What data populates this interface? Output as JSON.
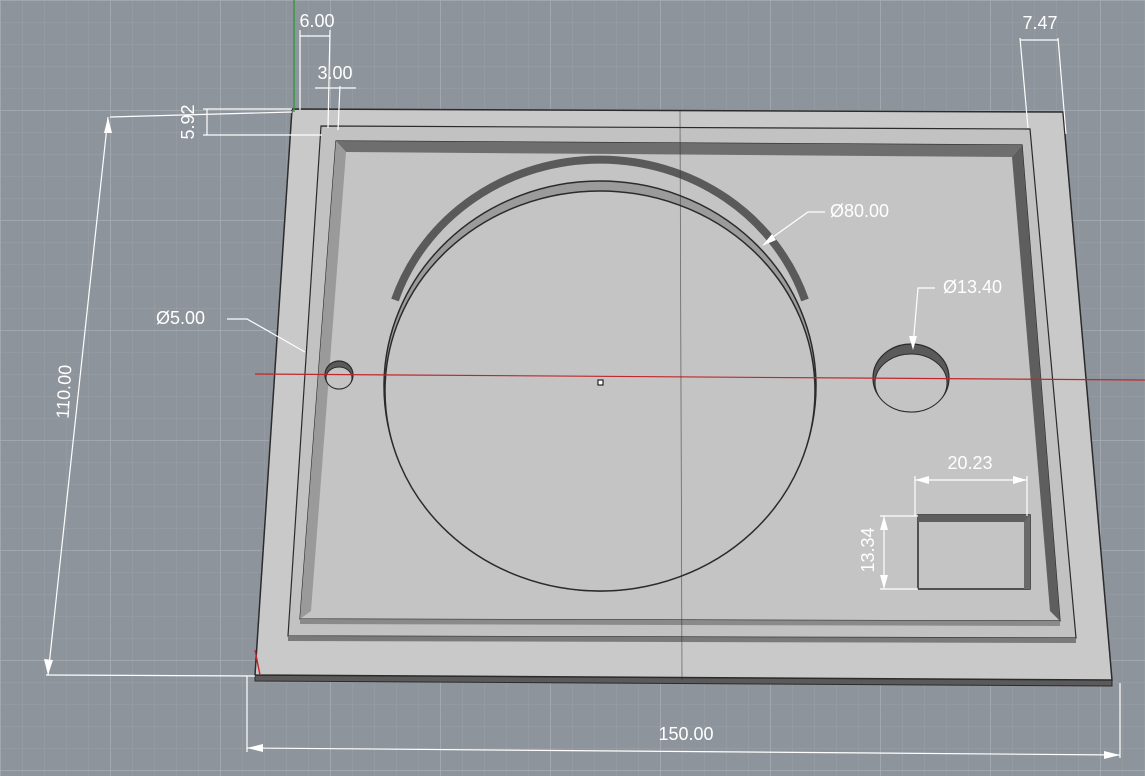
{
  "viewport": {
    "background": "#8e949b",
    "grid_minor_color": "#9aa0a6",
    "grid_major_color": "#a7adb3",
    "part_face_color": "#c7c7c7",
    "part_edge_color": "#2b2b2b",
    "x_axis_color": "#c0272d",
    "y_axis_color": "#2e9b3a"
  },
  "dimensions": {
    "width": "150.00",
    "height": "110.00",
    "border": "6.00",
    "inner_step": "3.00",
    "top_offset": "5.92",
    "right_offset": "7.47",
    "large_hole_dia": "Ø80.00",
    "small_hole_dia": "Ø5.00",
    "medium_hole_dia": "Ø13.40",
    "slot_width": "20.23",
    "slot_height": "13.34"
  }
}
